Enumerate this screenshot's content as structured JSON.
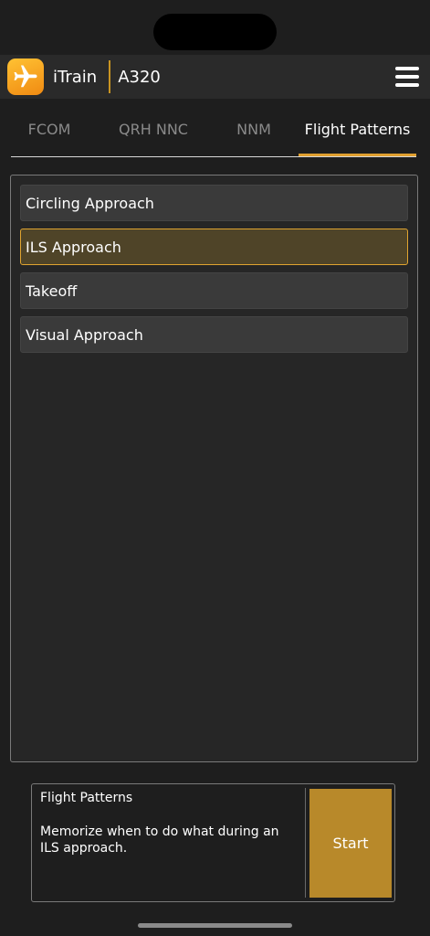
{
  "header": {
    "app_name": "iTrain",
    "model": "A320",
    "app_icon": "airplane-icon",
    "menu_icon": "hamburger-menu-icon"
  },
  "tabs": [
    {
      "label": "FCOM",
      "active": false
    },
    {
      "label": "QRH NNC",
      "active": false
    },
    {
      "label": "NNM",
      "active": false
    },
    {
      "label": "Flight Patterns",
      "active": true
    }
  ],
  "list": {
    "items": [
      {
        "label": "Circling Approach",
        "selected": false
      },
      {
        "label": "ILS Approach",
        "selected": true
      },
      {
        "label": "Takeoff",
        "selected": false
      },
      {
        "label": "Visual Approach",
        "selected": false
      }
    ]
  },
  "card": {
    "title": "Flight Patterns",
    "description": "Memorize when to do what during an ILS approach.",
    "start_label": "Start"
  },
  "colors": {
    "accent": "#e0a030",
    "start_button": "#b8892a",
    "selected_bg": "#4f4428"
  }
}
